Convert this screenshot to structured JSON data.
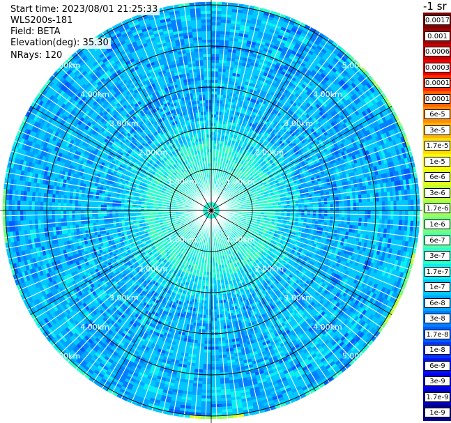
{
  "info": {
    "start_time": "Start time: 2023/08/01 21:25:33",
    "device": "WLS200s-181",
    "field": "Field: BETA",
    "elevation": "Elevation(deg): 35.30",
    "nrays": "NRays: 120"
  },
  "legend": {
    "unit": "-1 sr",
    "entries": [
      {
        "label": "0.0017",
        "color": "#7f0000"
      },
      {
        "label": "0.001",
        "color": "#a30000"
      },
      {
        "label": "0.0006",
        "color": "#c80000"
      },
      {
        "label": "0.0003",
        "color": "#ee0000"
      },
      {
        "label": "0.00017",
        "color": "#ff2a00"
      },
      {
        "label": "0.0001",
        "color": "#ff6200"
      },
      {
        "label": "6e-5",
        "color": "#ff8c00"
      },
      {
        "label": "3e-5",
        "color": "#ffb400"
      },
      {
        "label": "1.7e-5",
        "color": "#ffde00"
      },
      {
        "label": "1e-5",
        "color": "#fffb00"
      },
      {
        "label": "6e-6",
        "color": "#e2ff16"
      },
      {
        "label": "3e-6",
        "color": "#bfff3a"
      },
      {
        "label": "1.7e-6",
        "color": "#9cff5d"
      },
      {
        "label": "1e-6",
        "color": "#74ff84"
      },
      {
        "label": "6e-7",
        "color": "#50ffa8"
      },
      {
        "label": "3e-7",
        "color": "#2affcc"
      },
      {
        "label": "1.7e-7",
        "color": "#08f0f0"
      },
      {
        "label": "1e-7",
        "color": "#00c8ff"
      },
      {
        "label": "6e-8",
        "color": "#00a4ff"
      },
      {
        "label": "3e-8",
        "color": "#0080ff"
      },
      {
        "label": "1.7e-8",
        "color": "#005cff"
      },
      {
        "label": "1e-8",
        "color": "#0034ff"
      },
      {
        "label": "6e-9",
        "color": "#0010ff"
      },
      {
        "label": "3e-9",
        "color": "#0000e8"
      },
      {
        "label": "1.7e-9",
        "color": "#0000b8"
      },
      {
        "label": "1e-9",
        "color": "#000088"
      }
    ]
  },
  "chart_data": {
    "type": "heatmap",
    "projection": "polar-ppi",
    "nrays": 120,
    "range_rings_km": [
      1,
      2,
      3,
      4,
      5
    ],
    "ring_labels": [
      "1.00km",
      "2.00km",
      "3.00km",
      "4.00km",
      "5.00km"
    ],
    "max_range_km": 5.07,
    "spokes_deg": [
      0,
      30,
      60,
      90,
      120,
      150,
      180,
      210,
      240,
      270,
      300,
      330
    ],
    "dominant_value_range": [
      "1e-7",
      "1e-8"
    ],
    "edge_values": [
      "3e-7",
      "1.7e-5"
    ],
    "colormap": "jet"
  }
}
